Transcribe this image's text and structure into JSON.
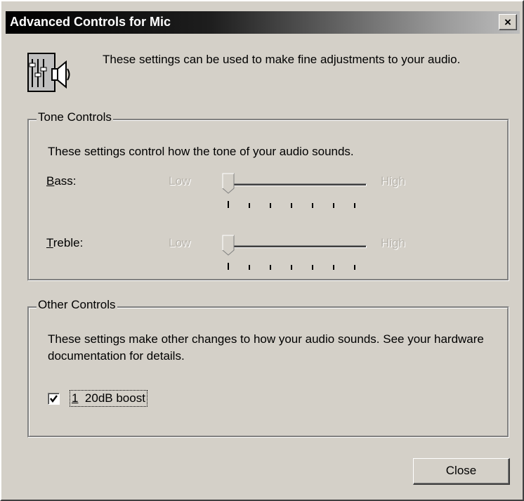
{
  "window": {
    "title": "Advanced Controls for Mic",
    "close_glyph": "×"
  },
  "intro": {
    "icon": "speaker-sliders-icon",
    "text": "These settings can be used to make fine adjustments to your audio."
  },
  "tone_controls": {
    "title": "Tone Controls",
    "description": "These settings control how the tone of your audio sounds.",
    "bass": {
      "label_key": "B",
      "label_rest": "ass:",
      "low": "Low",
      "high": "High",
      "value_fraction": 0,
      "tick_count": 7,
      "enabled": false
    },
    "treble": {
      "label_key": "T",
      "label_rest": "reble:",
      "low": "Low",
      "high": "High",
      "value_fraction": 0,
      "tick_count": 7,
      "enabled": false
    }
  },
  "other_controls": {
    "title": "Other Controls",
    "description": "These settings make other changes to how your audio sounds.  See your hardware documentation for details.",
    "boost": {
      "key": "1",
      "label": "20dB boost",
      "checked": true
    }
  },
  "buttons": {
    "close": "Close"
  }
}
